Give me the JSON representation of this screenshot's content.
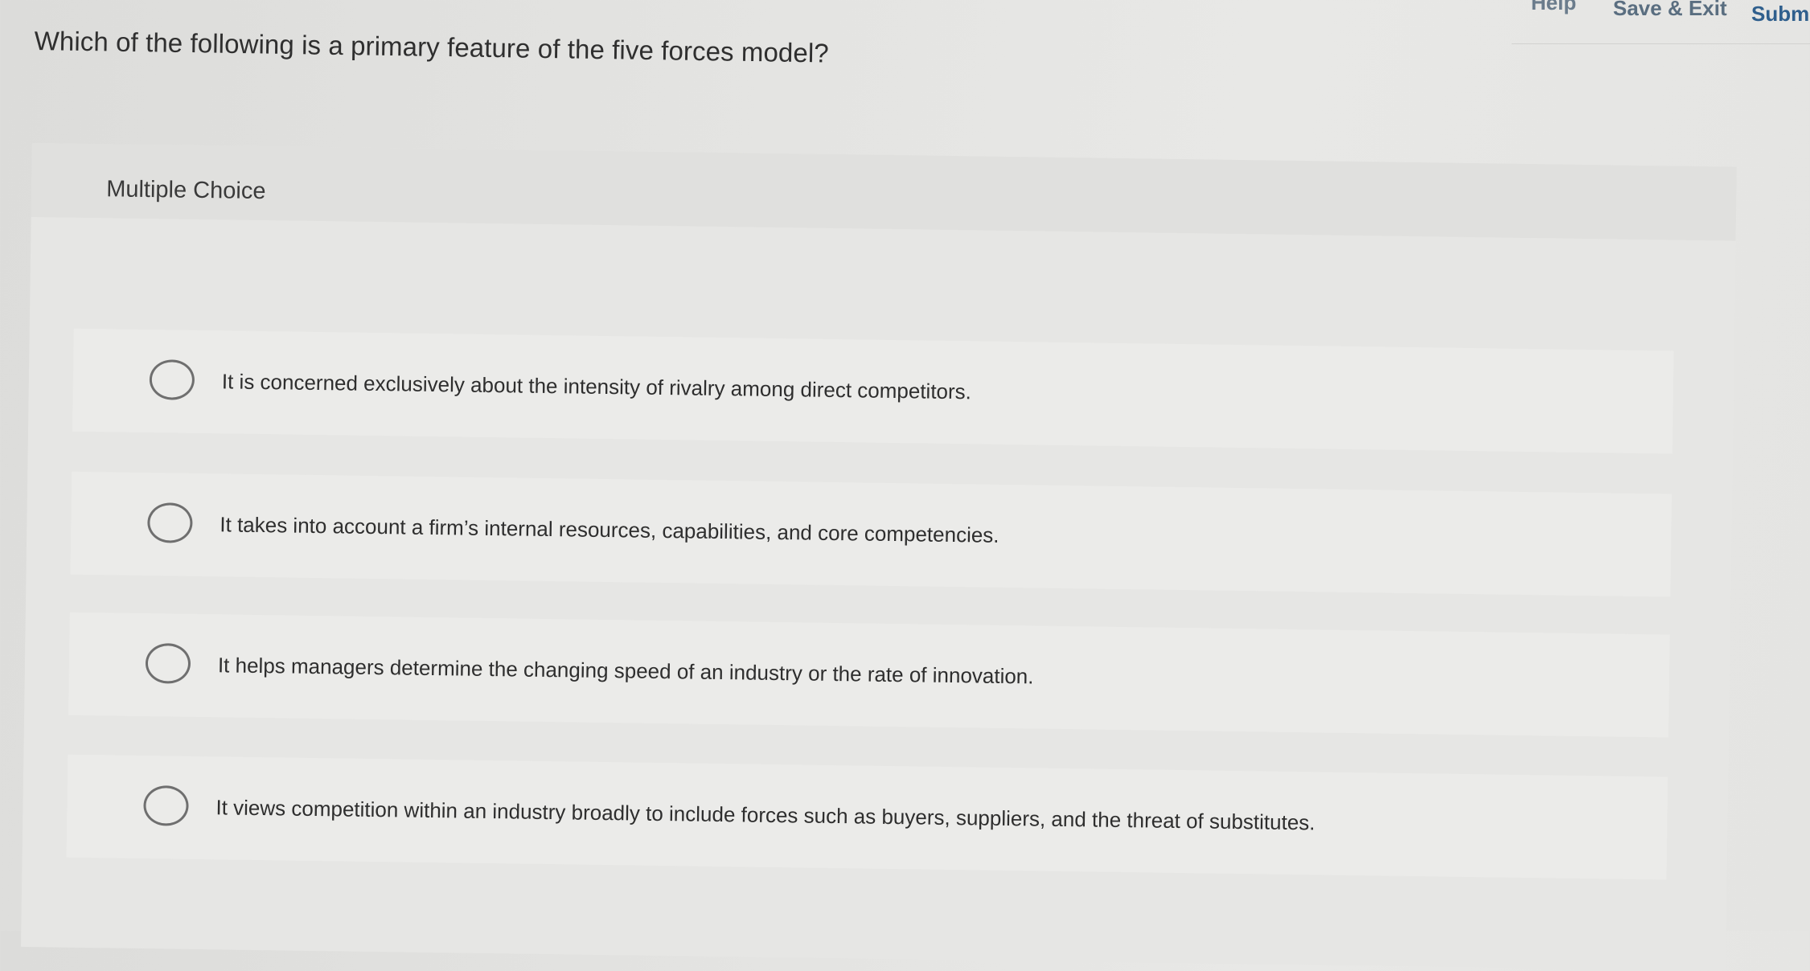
{
  "header": {
    "help_label": "Help",
    "save_exit_label": "Save & Exit",
    "submit_label": "Submit"
  },
  "question": {
    "text": "Which of the following is a primary feature of the five forces model?",
    "type_label": "Multiple Choice",
    "options": [
      {
        "label": "It is concerned exclusively about the intensity of rivalry among direct competitors.",
        "selected": false
      },
      {
        "label": "It takes into account a firm’s internal resources, capabilities, and core competencies.",
        "selected": false
      },
      {
        "label": "It helps managers determine the changing speed of an industry or the rate of innovation.",
        "selected": false
      },
      {
        "label": "It views competition within an industry broadly to include forces such as buyers, suppliers, and the threat of substitutes.",
        "selected": false
      }
    ]
  },
  "colors": {
    "submit_link": "#2f5f8d",
    "nav_link": "#5a6e80",
    "radio_border": "#6f6f6f"
  },
  "icons": [
    "radio-unselected-icon"
  ]
}
